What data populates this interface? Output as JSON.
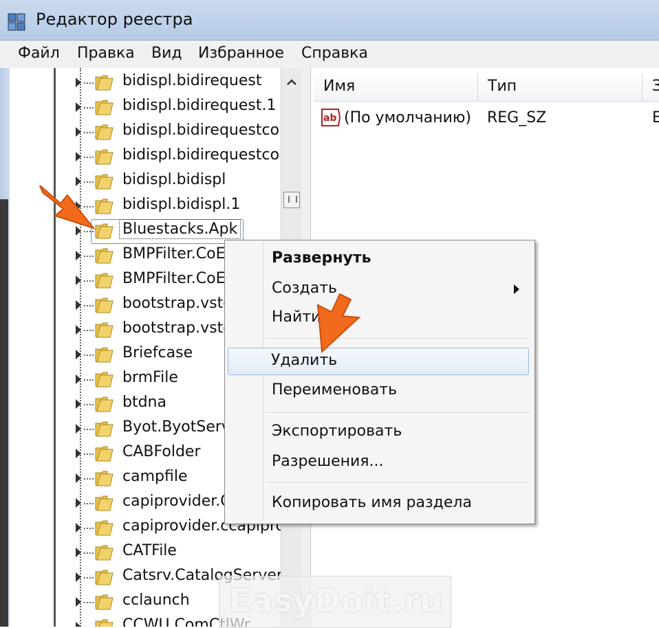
{
  "window": {
    "title": "Редактор реестра"
  },
  "menu": [
    "Файл",
    "Правка",
    "Вид",
    "Избранное",
    "Справка"
  ],
  "tree": {
    "items": [
      "bidispl.bidirequest",
      "bidispl.bidirequest.1",
      "bidispl.bidirequestcor",
      "bidispl.bidirequestcor",
      "bidispl.bidispl",
      "bidispl.bidispl.1",
      "Bluestacks.Apk",
      "BMPFilter.CoE",
      "BMPFilter.CoE",
      "bootstrap.vsto",
      "bootstrap.vsto",
      "Briefcase",
      "brmFile",
      "btdna",
      "Byot.ByotServ",
      "CABFolder",
      "campfile",
      "capiprovider.C",
      "capiprovider.ccapipro",
      "CATFile",
      "Catsrv.CatalogServer",
      "cclaunch",
      "CCWU.ComCtlWr"
    ],
    "selected_index": 6
  },
  "list": {
    "columns": [
      "Имя",
      "Тип",
      "З"
    ],
    "rows": [
      {
        "name": "(По умолчанию)",
        "type": "REG_SZ",
        "value": "Е"
      }
    ]
  },
  "context_menu": {
    "items": [
      {
        "label": "Развернуть",
        "bold": true
      },
      {
        "label": "Создать",
        "submenu": true
      },
      {
        "label": "Найти..."
      },
      {
        "label": "Удалить",
        "highlighted": true
      },
      {
        "label": "Переименовать"
      },
      {
        "label": "Экспортировать"
      },
      {
        "label": "Разрешения..."
      },
      {
        "label": "Копировать имя раздела"
      }
    ]
  },
  "watermark": "EasyDoit.ru",
  "colors": {
    "titlebar": "#b7cbe6",
    "folder": "#f2d36b",
    "highlight_border": "#9bb8dd",
    "arrow": "#f26a1b"
  },
  "icons": [
    "regedit-app-icon",
    "folder-icon",
    "expand-triangle-icon",
    "string-value-ab-icon",
    "scroll-up-icon",
    "submenu-arrow-icon",
    "pointer-arrow-icon"
  ]
}
